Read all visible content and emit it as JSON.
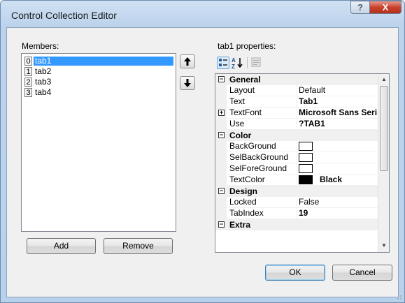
{
  "window": {
    "title": "Control Collection Editor",
    "help_label": "?",
    "close_label": "X"
  },
  "members": {
    "label": "Members:",
    "items": [
      {
        "index": "0",
        "name": "tab1",
        "selected": true
      },
      {
        "index": "1",
        "name": "tab2",
        "selected": false
      },
      {
        "index": "2",
        "name": "tab3",
        "selected": false
      },
      {
        "index": "3",
        "name": "tab4",
        "selected": false
      }
    ],
    "move_up_icon": "arrow-up",
    "move_down_icon": "arrow-down"
  },
  "buttons": {
    "add": "Add",
    "remove": "Remove",
    "ok": "OK",
    "cancel": "Cancel"
  },
  "properties": {
    "label": "tab1 properties:",
    "categories": [
      {
        "name": "General",
        "expander": "⊟",
        "props": [
          {
            "name": "Layout",
            "value": "Default",
            "bold": false
          },
          {
            "name": "Text",
            "value": "Tab1",
            "bold": true
          },
          {
            "name": "TextFont",
            "value": "Microsoft Sans Serif",
            "bold": true,
            "expander": "⊞"
          },
          {
            "name": "Use",
            "value": "?TAB1",
            "bold": true
          }
        ]
      },
      {
        "name": "Color",
        "expander": "⊟",
        "props": [
          {
            "name": "BackGround",
            "swatch": "#ffffff",
            "value": ""
          },
          {
            "name": "SelBackGround",
            "swatch": "#ffffff",
            "value": ""
          },
          {
            "name": "SelForeGround",
            "swatch": "#ffffff",
            "value": ""
          },
          {
            "name": "TextColor",
            "swatch": "#000000",
            "value": "Black"
          }
        ]
      },
      {
        "name": "Design",
        "expander": "⊟",
        "props": [
          {
            "name": "Locked",
            "value": "False",
            "bold": false
          },
          {
            "name": "TabIndex",
            "value": "19",
            "bold": true
          }
        ]
      },
      {
        "name": "Extra",
        "expander": "⊟",
        "props": []
      }
    ]
  },
  "colors": {
    "selection": "#3399ff",
    "title_bar": "#bcd3ec",
    "close_button": "#c8412c"
  }
}
